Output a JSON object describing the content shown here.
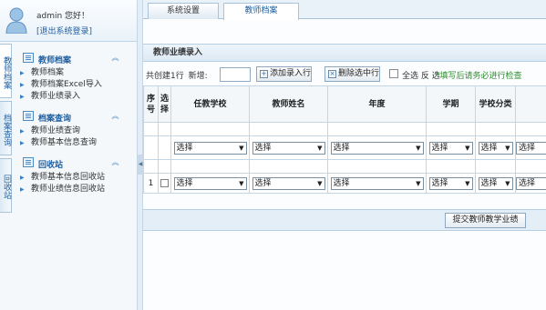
{
  "user": {
    "welcome": "admin 您好！",
    "logout": "[退出系统登录]"
  },
  "vertical_tabs": [
    {
      "label": "教师档案"
    },
    {
      "label": "档案查询"
    },
    {
      "label": "回收站"
    }
  ],
  "menu": [
    {
      "title": "教师档案",
      "items": [
        "教师档案",
        "教师档案Excel导入",
        "教师业绩录入"
      ]
    },
    {
      "title": "档案查询",
      "items": [
        "教师业绩查询",
        "教师基本信息查询"
      ]
    },
    {
      "title": "回收站",
      "items": [
        "教师基本信息回收站",
        "教师业绩信息回收站"
      ]
    }
  ],
  "top_tabs": [
    {
      "label": "系统设置",
      "active": false
    },
    {
      "label": "教师档案",
      "active": true
    }
  ],
  "panel": {
    "title": "教师业绩录入"
  },
  "toolbar": {
    "row_info": "共创建1行",
    "new_label": "新增:",
    "new_count_value": "",
    "add_row_label": "添加录入行",
    "delete_label": "删除选中行",
    "select_label": "全选 反 选",
    "hint": "*填写后请务必进行检查"
  },
  "table": {
    "headers": [
      "序号",
      "选择",
      "任教学校",
      "教师姓名",
      "年度",
      "学期",
      "学校分类",
      ""
    ],
    "select_placeholder": "选择",
    "data_row_index": "1"
  },
  "footer": {
    "submit_label": "提交教师教学业绩"
  },
  "colors": {
    "accent": "#1f5fa0",
    "hint": "#2e8b2e",
    "panel_bg": "#dce9f4"
  }
}
